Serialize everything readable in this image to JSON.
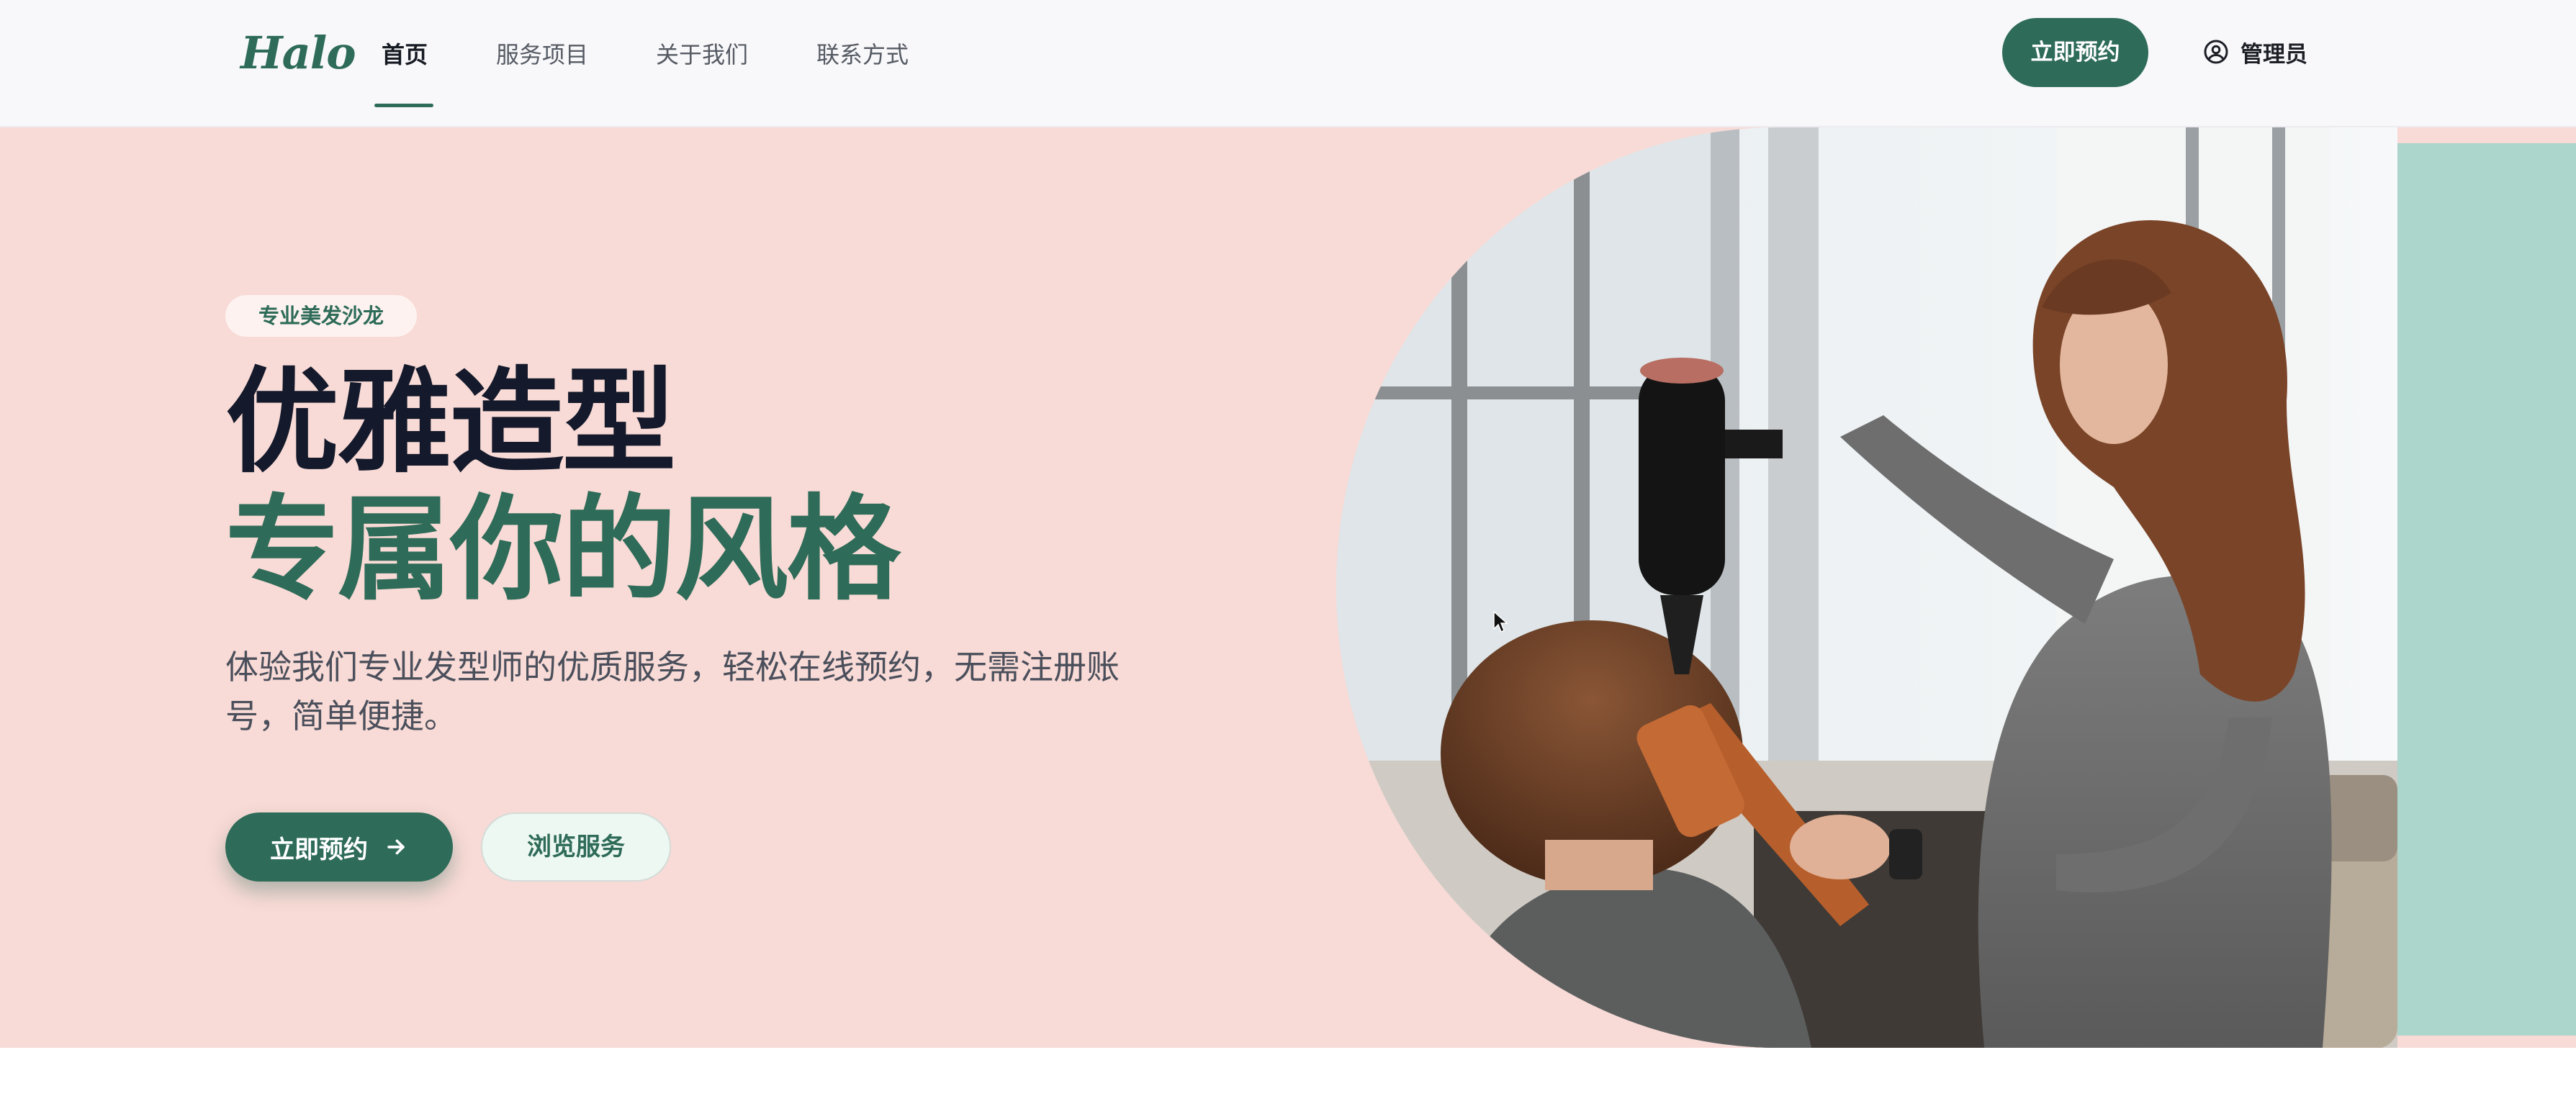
{
  "header": {
    "logo": "Halo",
    "nav": [
      {
        "label": "首页",
        "active": true
      },
      {
        "label": "服务项目",
        "active": false
      },
      {
        "label": "关于我们",
        "active": false
      },
      {
        "label": "联系方式",
        "active": false
      }
    ],
    "cta_label": "立即预约",
    "admin_label": "管理员"
  },
  "hero": {
    "badge": "专业美发沙龙",
    "title_line1": "优雅造型",
    "title_line2": "专属你的风格",
    "description": "体验我们专业发型师的优质服务，轻松在线预约，无需注册账号，简单便捷。",
    "primary_button": "立即预约",
    "secondary_button": "浏览服务",
    "image_subject": "salon-stylist-blow-drying-hair"
  },
  "colors": {
    "brand": "#2e6b58",
    "hero_background": "#f8dad6",
    "accent_teal": "#acd6cc",
    "header_background": "#f8f8fa",
    "title_dark": "#141a2b"
  },
  "icons": {
    "admin": "user-circle-icon",
    "primary_button": "arrow-right-icon"
  }
}
